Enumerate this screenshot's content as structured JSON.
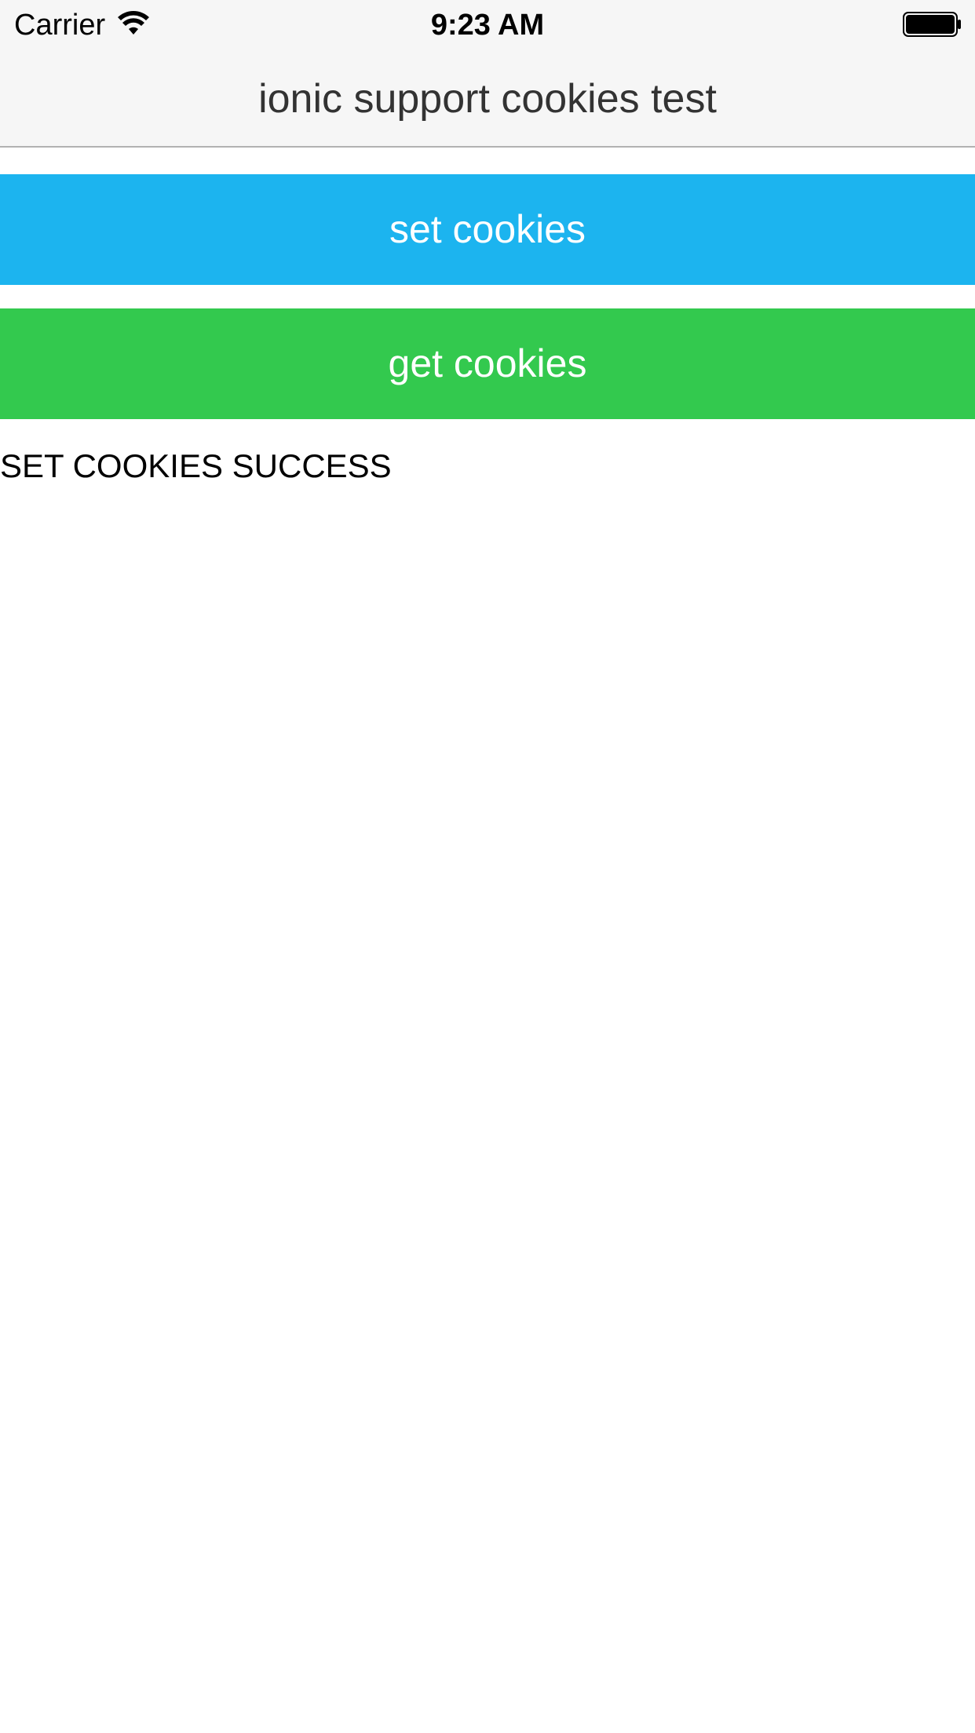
{
  "status_bar": {
    "carrier": "Carrier",
    "time": "9:23 AM",
    "wifi_icon": "wifi-icon",
    "battery_icon": "battery-icon"
  },
  "nav": {
    "title": "ionic support cookies test"
  },
  "buttons": {
    "set_label": "set cookies",
    "set_color": "#1cb4ef",
    "get_label": "get cookies",
    "get_color": "#33c94e"
  },
  "result": {
    "message": "SET COOKIES SUCCESS"
  }
}
